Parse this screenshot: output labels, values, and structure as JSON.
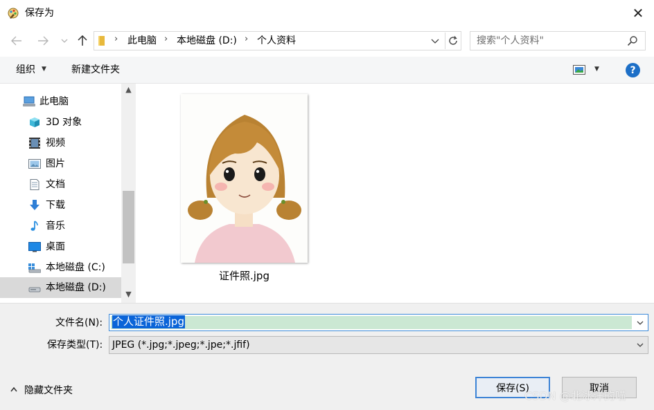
{
  "window": {
    "title": "保存为",
    "close_glyph": "✕"
  },
  "address": {
    "crumbs": [
      "此电脑",
      "本地磁盘 (D:)",
      "个人资料"
    ],
    "separator": "›"
  },
  "search": {
    "placeholder": "搜索\"个人资料\""
  },
  "toolbar": {
    "organize_label": "组织",
    "new_folder_label": "新建文件夹",
    "help_label": "?"
  },
  "nav": {
    "items": [
      {
        "label": "此电脑",
        "icon": "computer-icon"
      },
      {
        "label": "3D 对象",
        "icon": "cube-icon"
      },
      {
        "label": "视频",
        "icon": "video-icon"
      },
      {
        "label": "图片",
        "icon": "pictures-icon"
      },
      {
        "label": "文档",
        "icon": "document-icon"
      },
      {
        "label": "下载",
        "icon": "download-icon"
      },
      {
        "label": "音乐",
        "icon": "music-icon"
      },
      {
        "label": "桌面",
        "icon": "desktop-icon"
      },
      {
        "label": "本地磁盘 (C:)",
        "icon": "drive-c-icon"
      },
      {
        "label": "本地磁盘 (D:)",
        "icon": "drive-d-icon",
        "selected": true
      }
    ]
  },
  "files": [
    {
      "name": "证件照.jpg"
    }
  ],
  "form": {
    "filename_label": "文件名(N):",
    "filename_value": "个人证件照.jpg",
    "filetype_label": "保存类型(T):",
    "filetype_value": "JPEG (*.jpg;*.jpeg;*.jpe;*.jfif)"
  },
  "footer": {
    "hide_folders_label": "隐藏文件夹",
    "save_label": "保存(S)",
    "cancel_label": "取消",
    "watermark": "CSDN @北冰洋的喵"
  },
  "colors": {
    "accent": "#0a64d8",
    "filename_fill": "#cbe8d3",
    "selected_nav": "#d9d9d9"
  }
}
